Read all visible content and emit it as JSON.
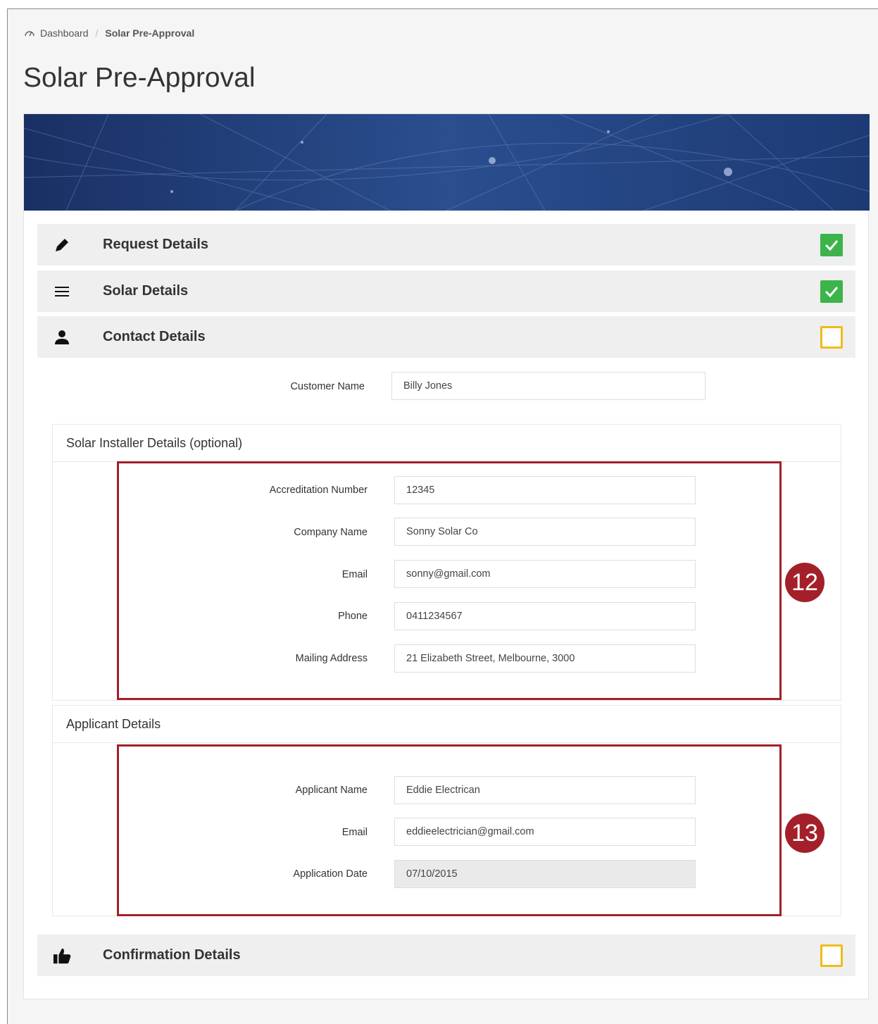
{
  "breadcrumb": {
    "home": "Dashboard",
    "current": "Solar Pre-Approval"
  },
  "page": {
    "title": "Solar Pre-Approval"
  },
  "sections": {
    "request": {
      "label": "Request Details",
      "status": "complete"
    },
    "solar": {
      "label": "Solar Details",
      "status": "complete"
    },
    "contact": {
      "label": "Contact Details",
      "status": "incomplete"
    },
    "confirmation": {
      "label": "Confirmation Details",
      "status": "incomplete"
    }
  },
  "contact": {
    "customer_name_label": "Customer Name",
    "customer_name_value": "Billy Jones"
  },
  "installer": {
    "heading": "Solar Installer Details (optional)",
    "accreditation_label": "Accreditation Number",
    "accreditation_value": "12345",
    "company_label": "Company Name",
    "company_value": "Sonny Solar Co",
    "email_label": "Email",
    "email_value": "sonny@gmail.com",
    "phone_label": "Phone",
    "phone_value": "0411234567",
    "address_label": "Mailing Address",
    "address_value": "21 Elizabeth Street, Melbourne, 3000",
    "callout": "12"
  },
  "applicant": {
    "heading": "Applicant Details",
    "name_label": "Applicant Name",
    "name_value": "Eddie Electrican",
    "email_label": "Email",
    "email_value": "eddieelectrician@gmail.com",
    "date_label": "Application Date",
    "date_value": "07/10/2015",
    "callout": "13"
  },
  "colors": {
    "complete": "#3cb44b",
    "incomplete": "#f0bb1a",
    "callout": "#a3202a",
    "banner": "#1c3b72"
  }
}
